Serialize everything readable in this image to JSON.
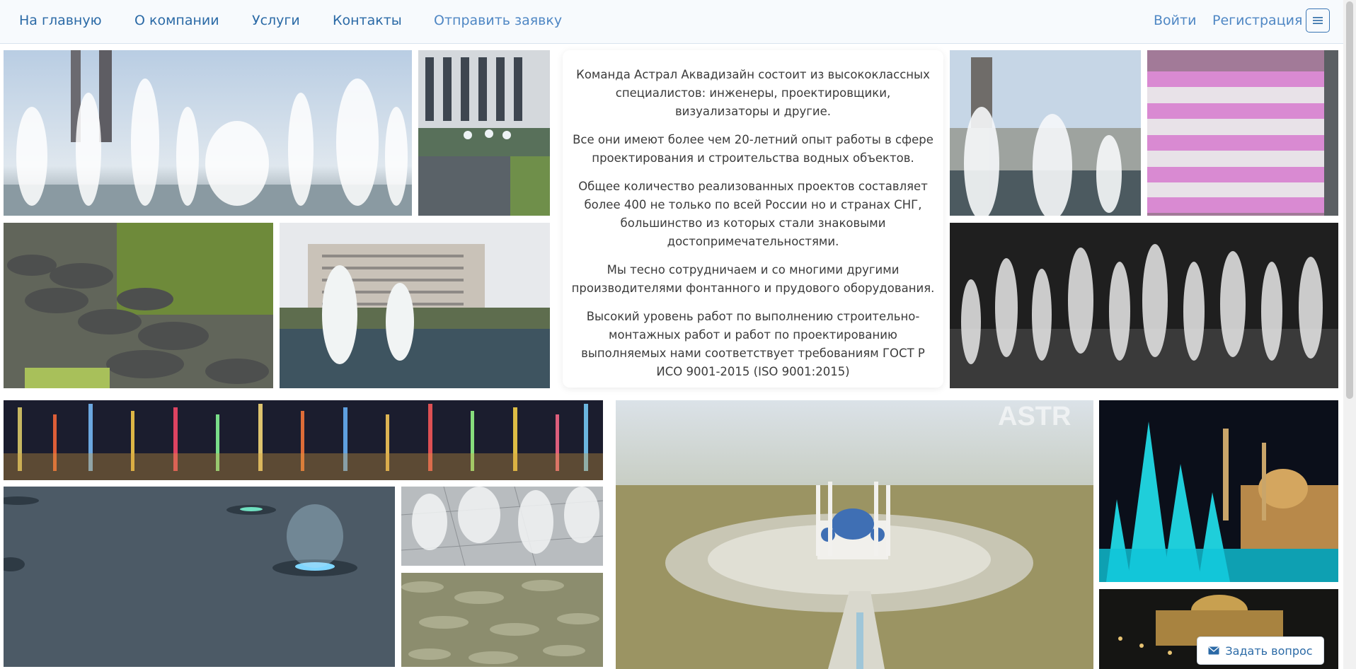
{
  "nav": {
    "home": "На главную",
    "about": "О компании",
    "services": "Услуги",
    "contacts": "Контакты",
    "request": "Отправить заявку",
    "login": "Войти",
    "register": "Регистрация"
  },
  "icons": {
    "menu": "hamburger-menu-icon",
    "mail": "envelope-icon"
  },
  "info": {
    "p1": "Команда Астрал Аквадизайн состоит из высококлассных специалистов: инженеры, проектировщики, визуализаторы и другие.",
    "p2": "Все они имеют более чем 20-летний опыт работы в сфере проектирования и строительства водных объектов.",
    "p3": "Общее количество реализованных проектов составляет более 400 не только по всей России но и странах СНГ, большинство из которых стали знаковыми достопримечательностями.",
    "p4": "Мы тесно сотрудничаем и со многими другими производителями фонтанного и прудового оборудования.",
    "p5": "Высокий уровень работ по выполнению строительно-монтажных работ и работ по проектированию выполняемых нами соответствует требованиям ГОСТ Р ИСО 9001-2015 (ISO 9001:2015)"
  },
  "watermark": "ASTR AQUADE",
  "ask_button": "Задать вопрос",
  "colors": {
    "nav_link": "#2b6aa6",
    "page_bg": "#ffffff"
  }
}
